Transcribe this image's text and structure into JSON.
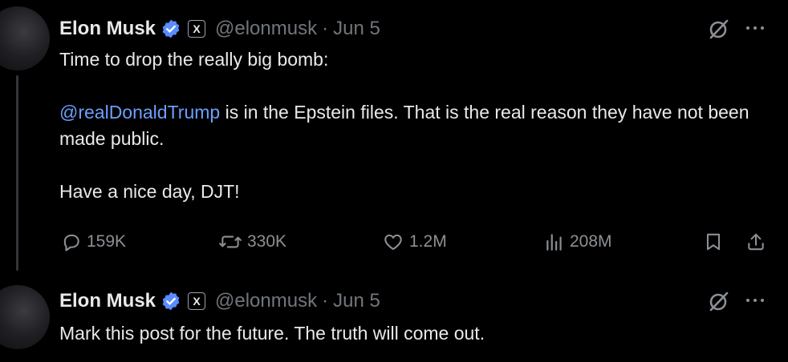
{
  "tweets": [
    {
      "author_name": "Elon Musk",
      "affiliation_badge": "X",
      "handle": "@elonmusk",
      "separator": "·",
      "date": "Jun 5",
      "text": {
        "line1": "Time to drop the really big bomb:",
        "mention": "@realDonaldTrump",
        "line2_rest": " is in the Epstein files. That is the real reason they have not been made public.",
        "line3": "Have a nice day, DJT!"
      },
      "stats": {
        "replies": "159K",
        "reposts": "330K",
        "likes": "1.2M",
        "views": "208M"
      }
    },
    {
      "author_name": "Elon Musk",
      "affiliation_badge": "X",
      "handle": "@elonmusk",
      "separator": "·",
      "date": "Jun 5",
      "text": {
        "line1": "Mark this post for the future. The truth will come out."
      }
    }
  ],
  "colors": {
    "background": "#000000",
    "primary_text": "#e7e9ea",
    "secondary_text": "#71767b",
    "mention": "#6d9eff",
    "verified": "#5b8cff"
  },
  "icons": {
    "verified": "verified-badge-icon",
    "grok": "grok-icon",
    "more": "more-dots-icon",
    "reply": "reply-icon",
    "repost": "repost-icon",
    "like": "like-icon",
    "views": "views-icon",
    "bookmark": "bookmark-icon",
    "share": "share-icon"
  }
}
